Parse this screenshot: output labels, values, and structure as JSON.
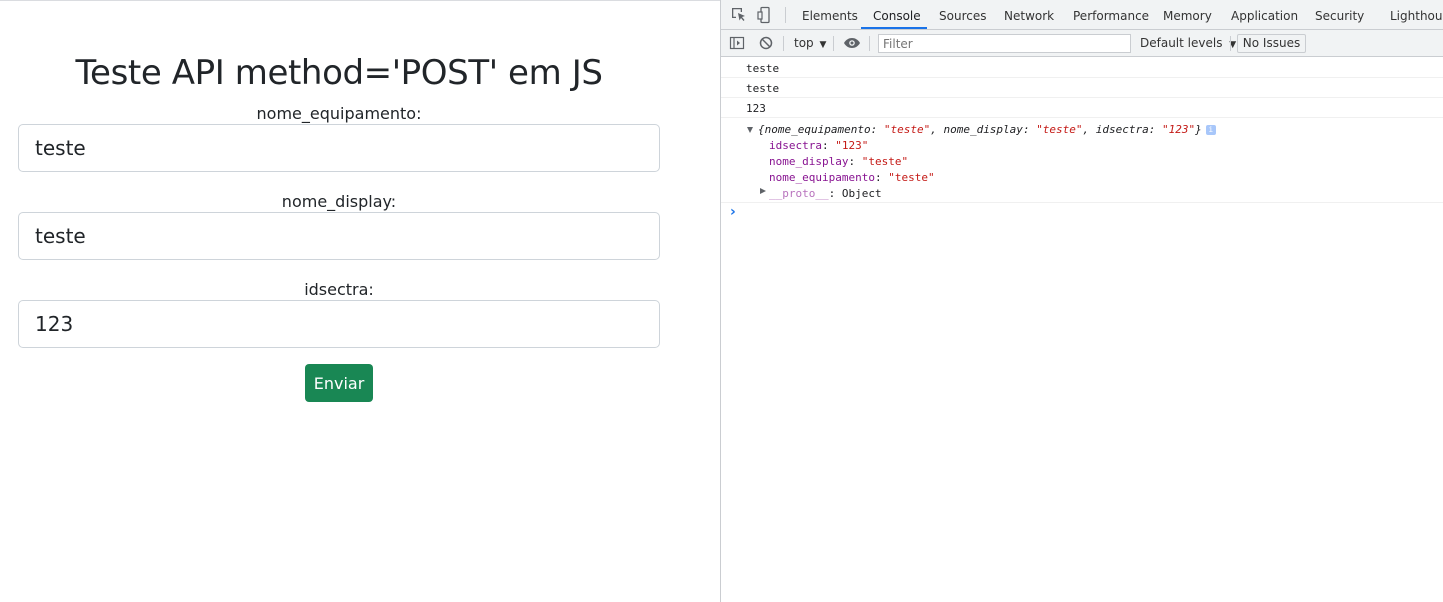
{
  "page": {
    "title": "Teste API method='POST' em JS",
    "fields": [
      {
        "label": "nome_equipamento:",
        "value": "teste"
      },
      {
        "label": "nome_display:",
        "value": "teste"
      },
      {
        "label": "idsectra:",
        "value": "123"
      }
    ],
    "submit_label": "Enviar"
  },
  "devtools": {
    "tabs": [
      "Elements",
      "Console",
      "Sources",
      "Network",
      "Performance",
      "Memory",
      "Application",
      "Security",
      "Lighthouse"
    ],
    "active_tab": "Console",
    "toolbar": {
      "context": "top",
      "filter_placeholder": "Filter",
      "levels": "Default levels",
      "issues": "No Issues"
    },
    "logs": [
      "teste",
      "teste",
      "123"
    ],
    "object_summary": {
      "open": "{",
      "k1": "nome_equipamento",
      "v1": "\"teste\"",
      "k2": "nome_display",
      "v2": "\"teste\"",
      "k3": "idsectra",
      "v3": "\"123\"",
      "close": "}"
    },
    "object_props": [
      {
        "key": "idsectra",
        "value": "\"123\""
      },
      {
        "key": "nome_display",
        "value": "\"teste\""
      },
      {
        "key": "nome_equipamento",
        "value": "\"teste\""
      }
    ],
    "proto": {
      "key": "__proto__",
      "value": "Object"
    },
    "prompt": "›"
  },
  "colors": {
    "primary_button": "#198754",
    "active_tab_underline": "#1a73e8"
  }
}
